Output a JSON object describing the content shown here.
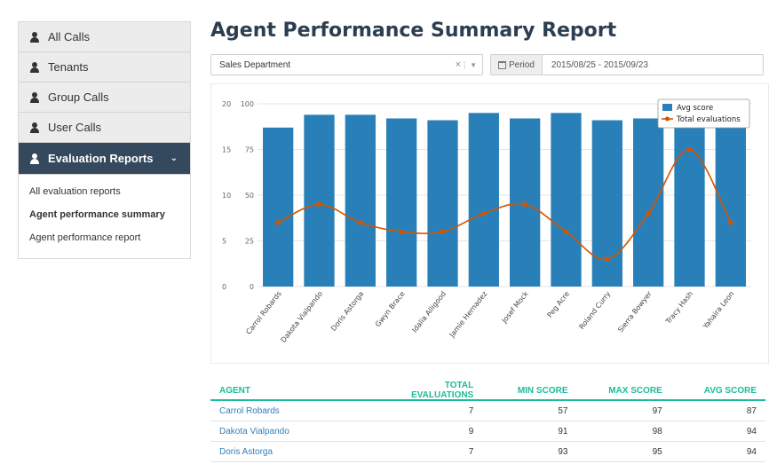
{
  "sidebar": {
    "items": [
      {
        "label": "All Calls"
      },
      {
        "label": "Tenants"
      },
      {
        "label": "Group Calls"
      },
      {
        "label": "User Calls"
      },
      {
        "label": "Evaluation Reports"
      }
    ],
    "sub_items": [
      {
        "label": "All evaluation reports"
      },
      {
        "label": "Agent performance summary"
      },
      {
        "label": "Agent performance report"
      }
    ]
  },
  "main": {
    "title": "Agent Performance Summary Report",
    "department": {
      "value": "Sales Department",
      "clear": "×",
      "caret": "▼"
    },
    "period": {
      "label": "Period",
      "value": "2015/08/25 - 2015/09/23"
    }
  },
  "chart_data": {
    "type": "bar",
    "categories": [
      "Carrol Robards",
      "Dakota Vialpando",
      "Doris Astorga",
      "Gwyn Brace",
      "Idalia Alligood",
      "Jamie Hernadez",
      "Josef Mock",
      "Peg Acre",
      "Roland Curry",
      "Sierra Bowyer",
      "Tracy Hash",
      "Yahaira Leon"
    ],
    "series": [
      {
        "name": "Avg score",
        "type": "bar",
        "color": "#2980b9",
        "values": [
          87,
          94,
          94,
          92,
          91,
          95,
          92,
          95,
          91,
          92,
          90,
          92
        ]
      },
      {
        "name": "Total evaluations",
        "type": "line",
        "color": "#d35400",
        "values": [
          7,
          9,
          7,
          6,
          6,
          8,
          9,
          6,
          3,
          8,
          15,
          7
        ]
      }
    ],
    "left_axis_ticks": [
      "0",
      "5",
      "10",
      "15",
      "20"
    ],
    "right_axis_ticks": [
      "0",
      "25",
      "50",
      "75",
      "100"
    ],
    "ylim_left": [
      0,
      20
    ],
    "ylim_right": [
      0,
      100
    ],
    "legend_position": "top-right",
    "grid": true
  },
  "table": {
    "headers": [
      "AGENT",
      "TOTAL EVALUATIONS",
      "MIN SCORE",
      "MAX SCORE",
      "AVG SCORE"
    ],
    "rows": [
      [
        "Carrol Robards",
        "7",
        "57",
        "97",
        "87"
      ],
      [
        "Dakota Vialpando",
        "9",
        "91",
        "98",
        "94"
      ],
      [
        "Doris Astorga",
        "7",
        "93",
        "95",
        "94"
      ]
    ]
  }
}
